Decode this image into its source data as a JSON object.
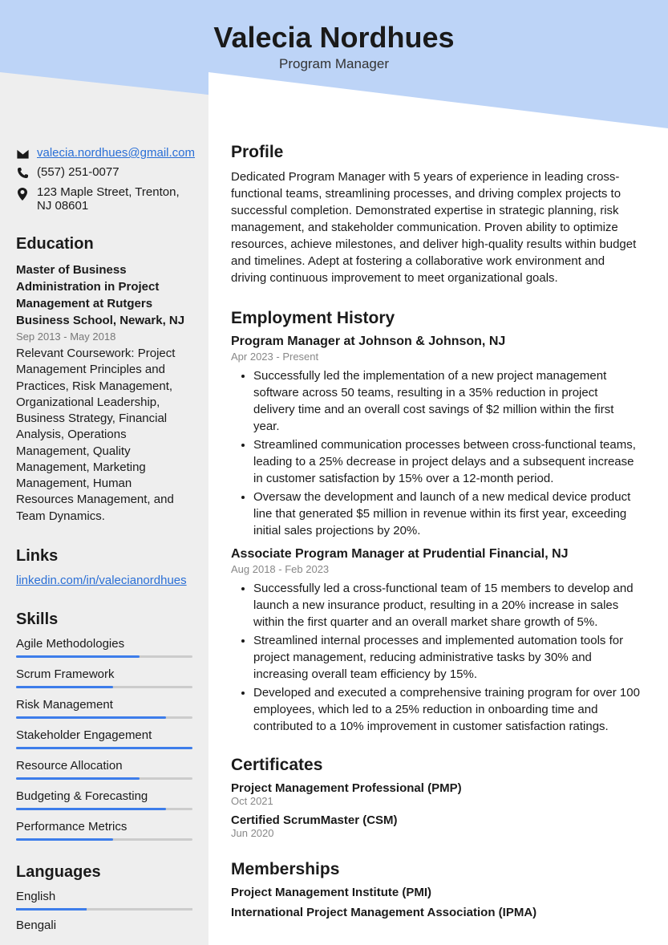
{
  "header": {
    "name": "Valecia Nordhues",
    "title": "Program Manager"
  },
  "contact": {
    "email": "valecia.nordhues@gmail.com",
    "phone": "(557) 251-0077",
    "address": "123 Maple Street, Trenton, NJ 08601"
  },
  "sections": {
    "education": "Education",
    "links": "Links",
    "skills": "Skills",
    "languages": "Languages",
    "profile": "Profile",
    "employment": "Employment History",
    "certificates": "Certificates",
    "memberships": "Memberships"
  },
  "education": {
    "degree": "Master of Business Administration in Project Management at Rutgers Business School, Newark, NJ",
    "dates": "Sep 2013 - May 2018",
    "desc": "Relevant Coursework: Project Management Principles and Practices, Risk Management, Organizational Leadership, Business Strategy, Financial Analysis, Operations Management, Quality Management, Marketing Management, Human Resources Management, and Team Dynamics."
  },
  "links": {
    "linkedin": "linkedin.com/in/valecianordhues"
  },
  "skills": [
    {
      "name": "Agile Methodologies",
      "pct": 70
    },
    {
      "name": "Scrum Framework",
      "pct": 55
    },
    {
      "name": "Risk Management",
      "pct": 85
    },
    {
      "name": "Stakeholder Engagement",
      "pct": 100
    },
    {
      "name": "Resource Allocation",
      "pct": 70
    },
    {
      "name": "Budgeting & Forecasting",
      "pct": 85
    },
    {
      "name": "Performance Metrics",
      "pct": 55
    }
  ],
  "languages": [
    {
      "name": "English",
      "pct": 40
    },
    {
      "name": "Bengali",
      "pct": 0
    }
  ],
  "profile": "Dedicated Program Manager with 5 years of experience in leading cross-functional teams, streamlining processes, and driving complex projects to successful completion. Demonstrated expertise in strategic planning, risk management, and stakeholder communication. Proven ability to optimize resources, achieve milestones, and deliver high-quality results within budget and timelines. Adept at fostering a collaborative work environment and driving continuous improvement to meet organizational goals.",
  "employment": [
    {
      "title": "Program Manager at Johnson & Johnson, NJ",
      "dates": "Apr 2023 - Present",
      "bullets": [
        "Successfully led the implementation of a new project management software across 50 teams, resulting in a 35% reduction in project delivery time and an overall cost savings of $2 million within the first year.",
        "Streamlined communication processes between cross-functional teams, leading to a 25% decrease in project delays and a subsequent increase in customer satisfaction by 15% over a 12-month period.",
        "Oversaw the development and launch of a new medical device product line that generated $5 million in revenue within its first year, exceeding initial sales projections by 20%."
      ]
    },
    {
      "title": "Associate Program Manager at Prudential Financial, NJ",
      "dates": "Aug 2018 - Feb 2023",
      "bullets": [
        "Successfully led a cross-functional team of 15 members to develop and launch a new insurance product, resulting in a 20% increase in sales within the first quarter and an overall market share growth of 5%.",
        "Streamlined internal processes and implemented automation tools for project management, reducing administrative tasks by 30% and increasing overall team efficiency by 15%.",
        "Developed and executed a comprehensive training program for over 100 employees, which led to a 25% reduction in onboarding time and contributed to a 10% improvement in customer satisfaction ratings."
      ]
    }
  ],
  "certificates": [
    {
      "title": "Project Management Professional (PMP)",
      "date": "Oct 2021"
    },
    {
      "title": "Certified ScrumMaster (CSM)",
      "date": "Jun 2020"
    }
  ],
  "memberships": [
    "Project Management Institute (PMI)",
    "International Project Management Association (IPMA)"
  ]
}
